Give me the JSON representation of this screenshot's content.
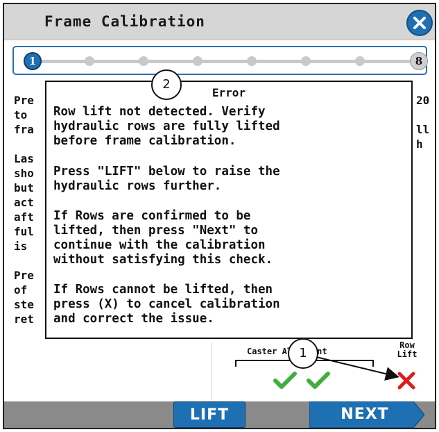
{
  "window": {
    "title": "Frame Calibration",
    "close_icon": "close-icon"
  },
  "progress": {
    "current_step": "1",
    "total_steps": "8",
    "active_color": "#1f6fb3"
  },
  "background_text": {
    "left_lines": "Pre\nto \nfra\n\nLas\nsho\nbut\nact\naft\nful\nis \n\nPre\nof \nste\nret",
    "right_lines": "20\n\nll\nh"
  },
  "status_panel": {
    "caster_alignment_label": "Caster Alignment",
    "row_lift_label": "Row\nLift",
    "caster_checks": [
      "check-icon",
      "check-icon"
    ],
    "row_lift_status": "x-icon",
    "ok_color": "#3fae3f",
    "fail_color": "#e01b1b"
  },
  "error_dialog": {
    "title": "Error",
    "paragraph_1": "Row lift not detected. Verify\nhydraulic rows are fully lifted\nbefore frame calibration.",
    "paragraph_2": "Press \"LIFT\" below to raise the\nhydraulic rows further.",
    "paragraph_3": "If Rows are confirmed to be\nlifted, then press \"Next\" to\ncontinue with the calibration\nwithout satisfying this check.",
    "paragraph_4": "If Rows cannot be lifted, then\npress (X) to cancel calibration\nand correct the issue."
  },
  "callouts": {
    "one": "1",
    "two": "2"
  },
  "footer": {
    "lift_label": "LIFT",
    "next_label": "NEXT",
    "button_color": "#1f6fb3"
  }
}
